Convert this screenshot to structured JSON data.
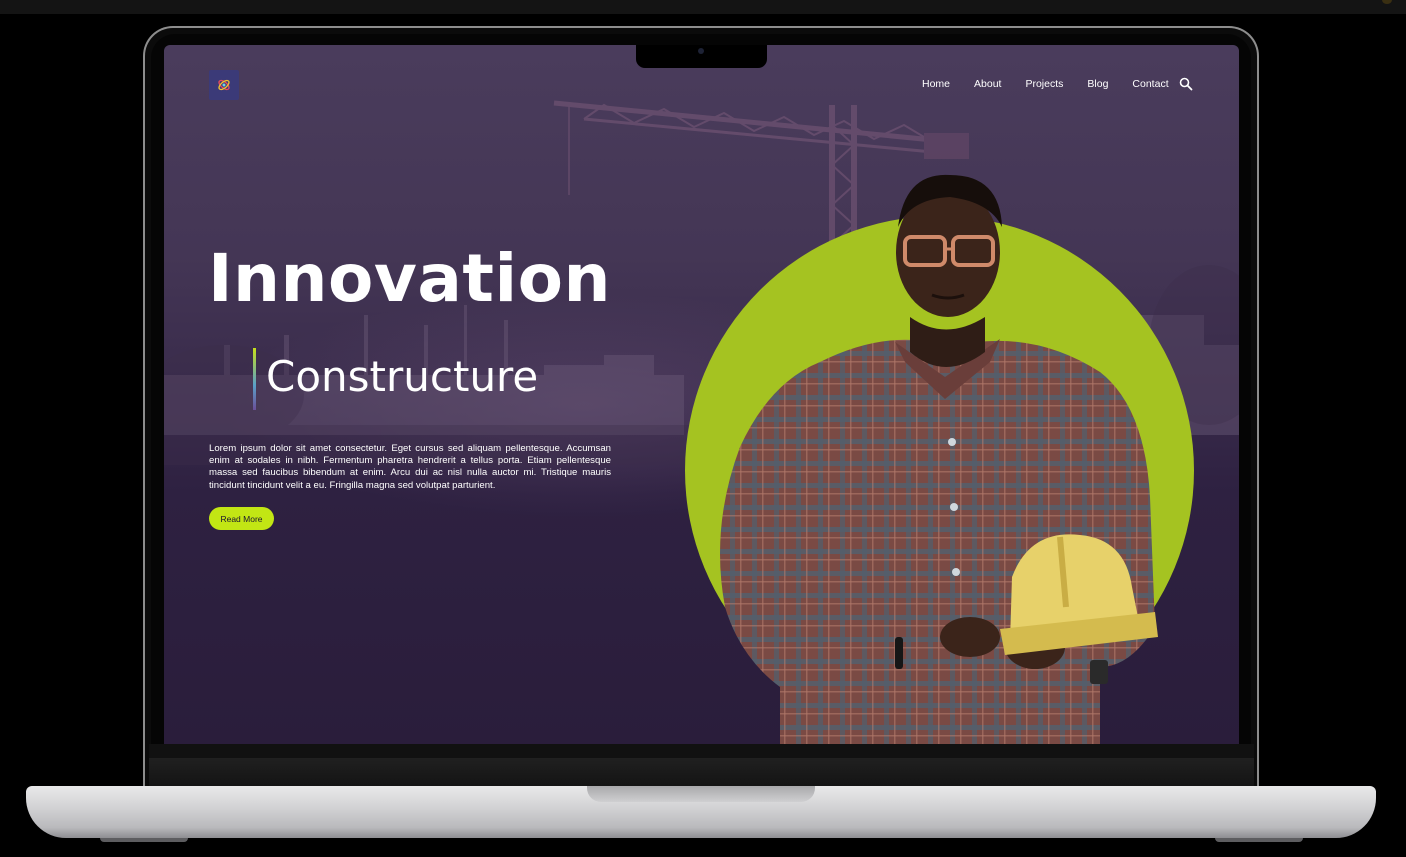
{
  "site": {
    "nav": {
      "items": [
        {
          "label": "Home"
        },
        {
          "label": "About"
        },
        {
          "label": "Projects"
        },
        {
          "label": "Blog"
        },
        {
          "label": "Contact"
        }
      ],
      "search_icon": "search-icon"
    },
    "logo_icon": "atom-logo-icon",
    "hero": {
      "title": "Innovation",
      "subtitle": "Constructure",
      "paragraph": "Lorem ipsum dolor sit amet consectetur. Eget cursus sed aliquam pellentesque. Accumsan enim at sodales in nibh. Fermentum pharetra hendrerit a tellus porta. Etiam pellentesque massa sed faucibus bibendum at enim. Arcu dui ac nisl nulla auctor mi. Tristique mauris tincidunt tincidunt velit a eu. Fringilla magna sed volutpat parturient.",
      "button_label": "Read More"
    },
    "colors": {
      "accent": "#c2e614",
      "circle": "#a5c321",
      "background": "#2e2141",
      "logo_bg": "#3b3a78"
    }
  }
}
